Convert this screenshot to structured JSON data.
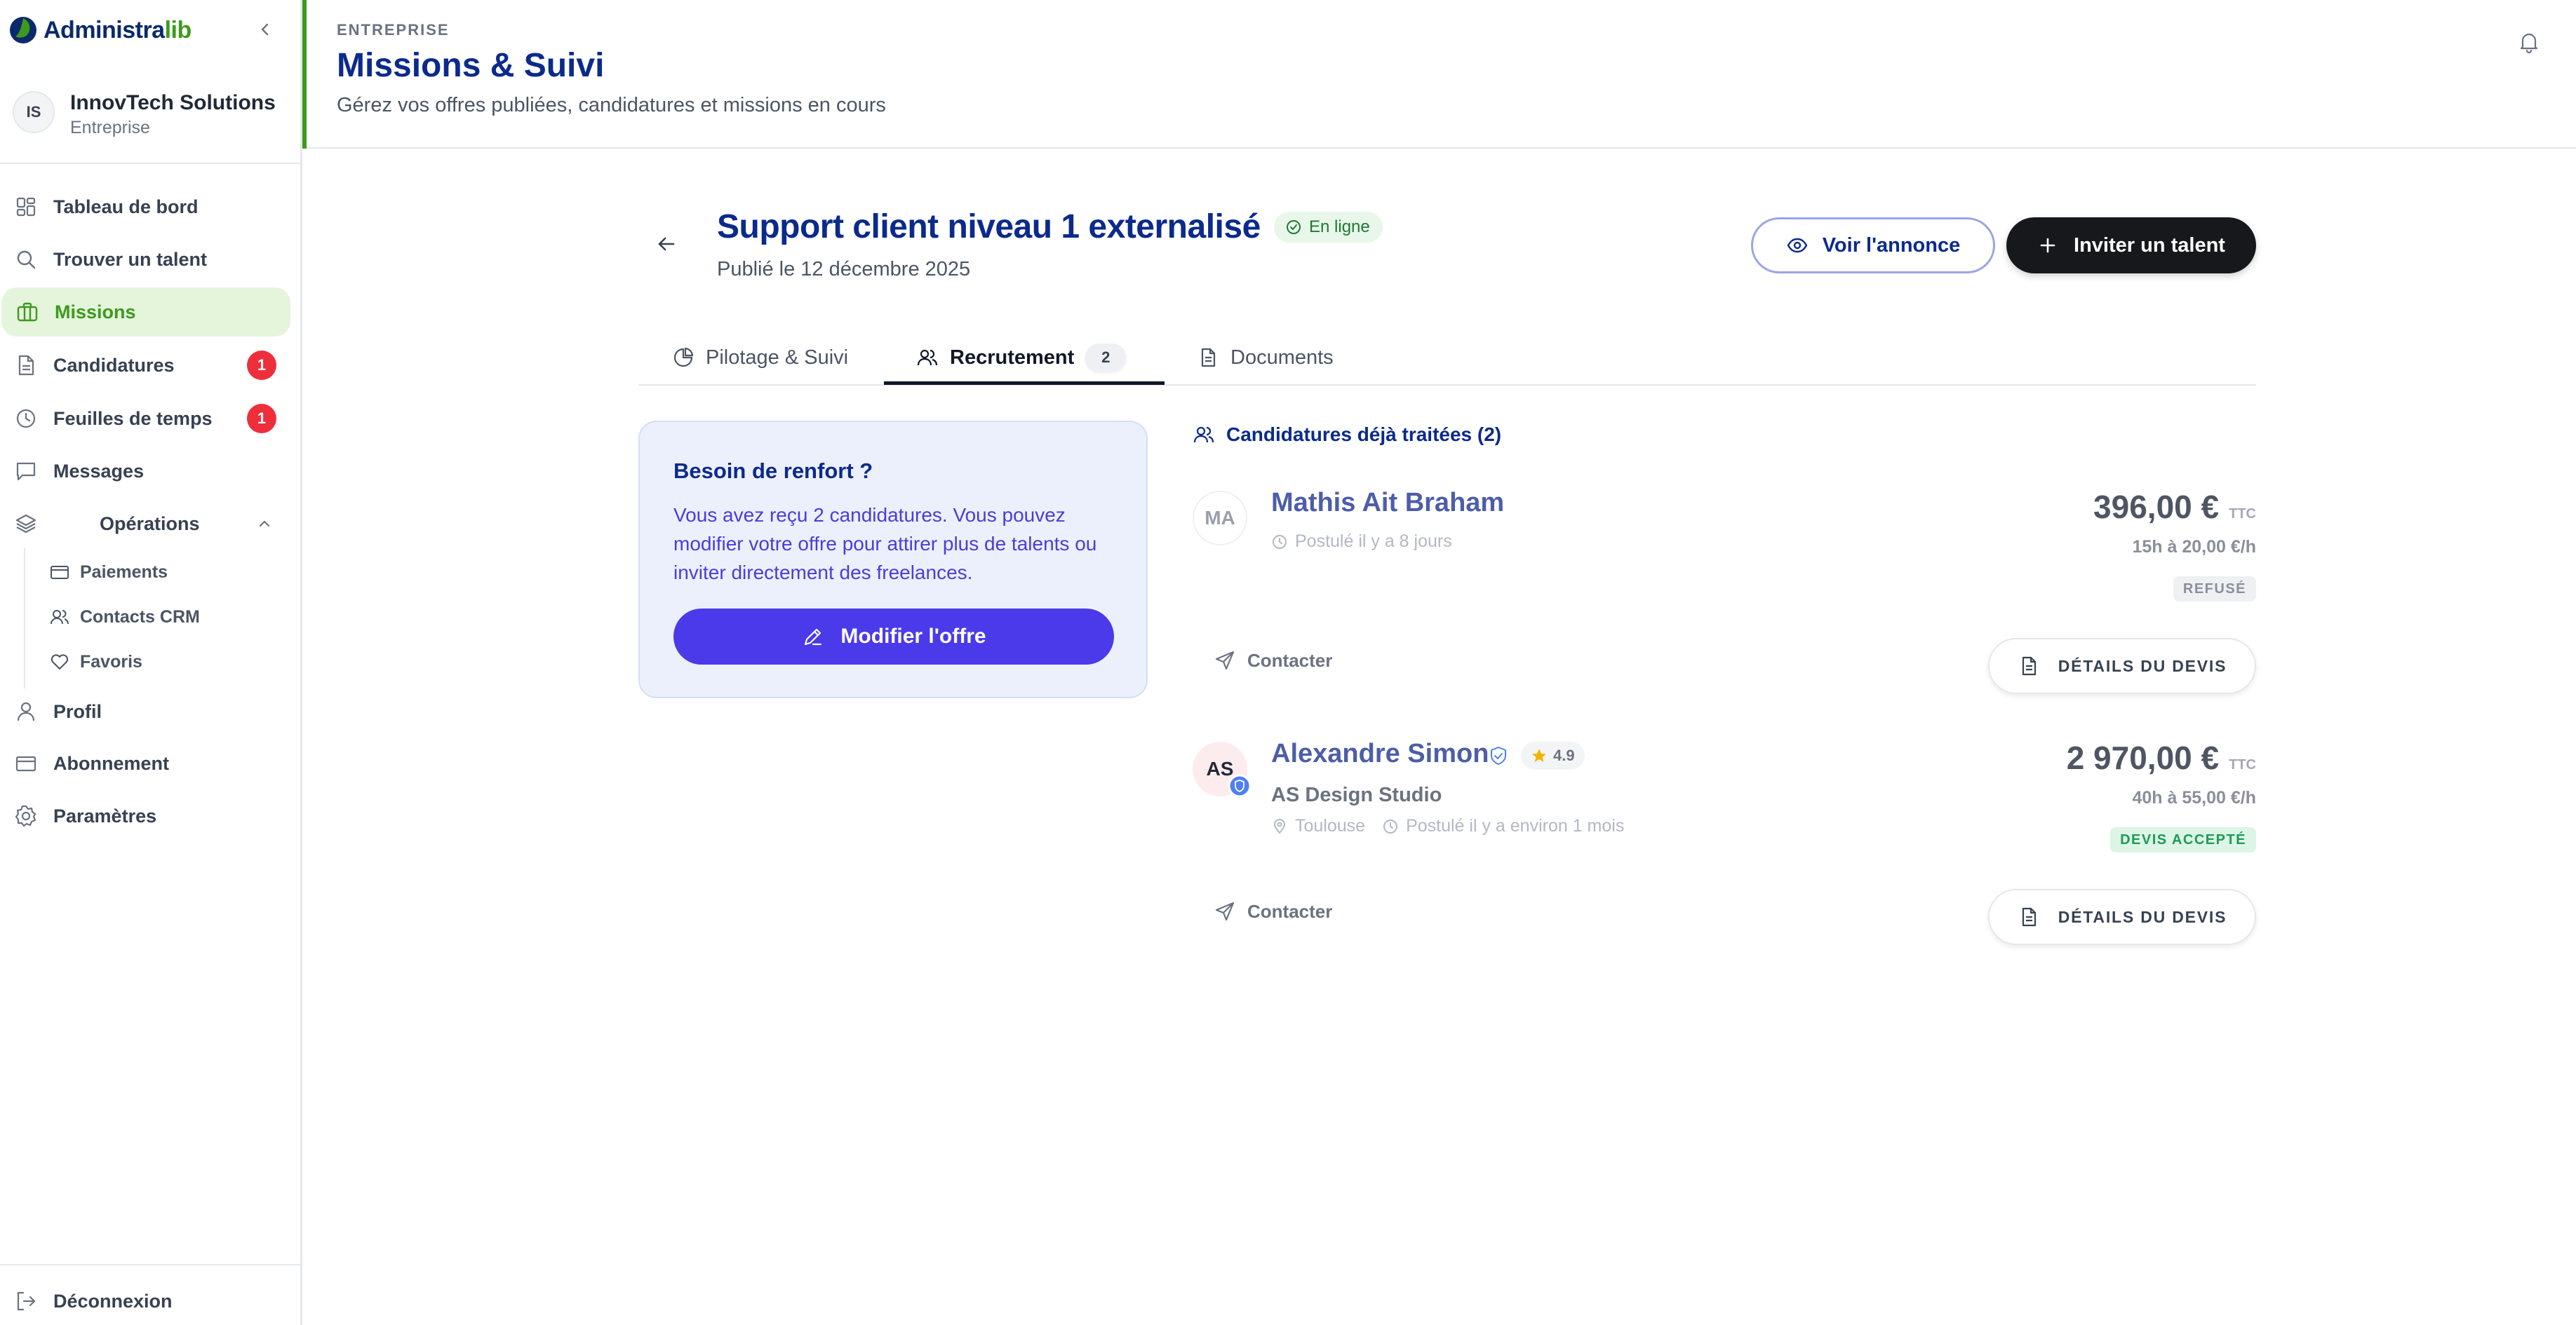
{
  "brand": {
    "name_part1": "Administra",
    "name_part2": "lib"
  },
  "organization": {
    "initials": "IS",
    "name": "InnovTech Solutions",
    "type": "Entreprise"
  },
  "nav": {
    "dashboard": "Tableau de bord",
    "find_talent": "Trouver un talent",
    "missions": "Missions",
    "applications": "Candidatures",
    "applications_badge": "1",
    "timesheets": "Feuilles de temps",
    "timesheets_badge": "1",
    "messages": "Messages",
    "operations": "Opérations",
    "payments": "Paiements",
    "crm_contacts": "Contacts CRM",
    "favorites": "Favoris",
    "profile": "Profil",
    "subscription": "Abonnement",
    "settings": "Paramètres",
    "logout": "Déconnexion"
  },
  "header": {
    "eyebrow": "ENTREPRISE",
    "title": "Missions & Suivi",
    "subtitle": "Gérez vos offres publiées, candidatures et missions en cours"
  },
  "mission": {
    "title": "Support client niveau 1 externalisé",
    "status": "En ligne",
    "published": "Publié le 12 décembre 2025",
    "view_listing": "Voir l'annonce",
    "invite_talent": "Inviter un talent"
  },
  "tabs": [
    {
      "label": "Pilotage & Suivi"
    },
    {
      "label": "Recrutement",
      "count": "2"
    },
    {
      "label": "Documents"
    }
  ],
  "promo": {
    "title": "Besoin de renfort ?",
    "text": "Vous avez reçu 2 candidatures. Vous pouvez modifier votre offre pour attirer plus de talents ou inviter directement des freelances.",
    "button": "Modifier l'offre"
  },
  "candidates_section": {
    "title": "Candidatures déjà traitées (2)"
  },
  "candidates": [
    {
      "initials": "MA",
      "name": "Mathis Ait Braham",
      "applied": "Postulé il y a 8 jours",
      "amount": "396,00 €",
      "tax": "TTC",
      "rate": "15h à 20,00 €/h",
      "status": "REFUSÉ",
      "contact": "Contacter",
      "details": "DÉTAILS DU DEVIS"
    },
    {
      "initials": "AS",
      "name": "Alexandre Simon",
      "rating": "4.9",
      "company": "AS Design Studio",
      "location": "Toulouse",
      "applied": "Postulé il y a environ 1 mois",
      "amount": "2 970,00 €",
      "tax": "TTC",
      "rate": "40h à 55,00 €/h",
      "status": "DEVIS ACCEPTÉ",
      "contact": "Contacter",
      "details": "DÉTAILS DU DEVIS"
    }
  ],
  "colors": {
    "brand_navy": "#0b2a8c",
    "brand_green": "#3d9a1c",
    "accent_purple": "#4a3aea",
    "badge_red": "#ef2e3c"
  }
}
